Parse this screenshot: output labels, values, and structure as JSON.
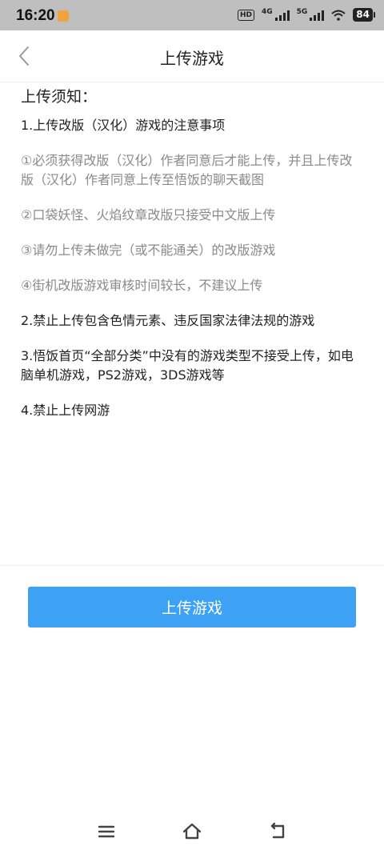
{
  "status_bar": {
    "time": "16:20",
    "hd_label": "HD",
    "net1": "4G",
    "net2": "5G",
    "battery": "84"
  },
  "header": {
    "title": "上传游戏"
  },
  "notice": {
    "title": "上传须知：",
    "rules": [
      {
        "text": "1.上传改版（汉化）游戏的注意事项",
        "style": "primary"
      },
      {
        "text": "①必须获得改版（汉化）作者同意后才能上传，并且上传改版（汉化）作者同意上传至悟饭的聊天截图",
        "style": "sub"
      },
      {
        "text": "②口袋妖怪、火焰纹章改版只接受中文版上传",
        "style": "sub"
      },
      {
        "text": "③请勿上传未做完（或不能通关）的改版游戏",
        "style": "sub"
      },
      {
        "text": "④街机改版游戏审核时间较长，不建议上传",
        "style": "sub"
      },
      {
        "text": "2.禁止上传包含色情元素、违反国家法律法规的游戏",
        "style": "primary"
      },
      {
        "text": "3.悟饭首页“全部分类”中没有的游戏类型不接受上传，如电脑单机游戏，PS2游戏，3DS游戏等",
        "style": "primary"
      },
      {
        "text": "4.禁止上传网游",
        "style": "primary"
      }
    ]
  },
  "upload_button": {
    "label": "上传游戏"
  },
  "colors": {
    "accent": "#3da2f3",
    "status_bar_bg": "#bfbfbf",
    "sub_text": "#8a8a8a"
  },
  "icons": {
    "back": "chevron-left-icon",
    "menu": "menu-icon",
    "home": "home-icon",
    "return": "return-icon"
  }
}
